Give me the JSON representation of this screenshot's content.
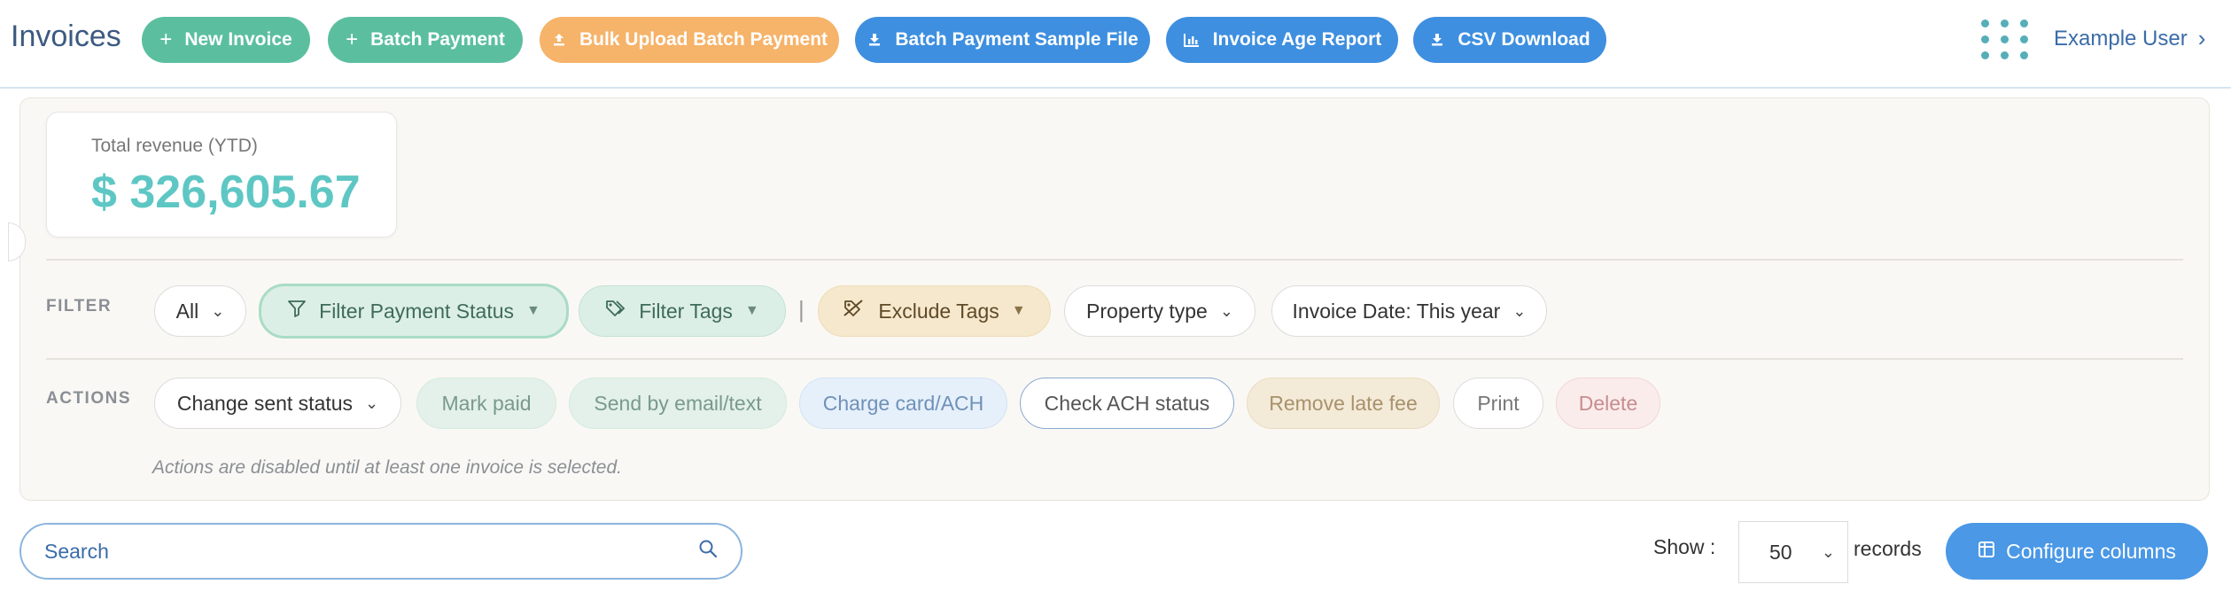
{
  "header": {
    "title": "Invoices",
    "buttons": {
      "new_invoice": "New Invoice",
      "batch_payment": "Batch Payment",
      "bulk_upload": "Bulk Upload Batch Payment",
      "sample_file": "Batch Payment Sample File",
      "age_report": "Invoice Age Report",
      "csv_download": "CSV Download"
    },
    "user_name": "Example User"
  },
  "revenue": {
    "label": "Total revenue (YTD)",
    "value": "$ 326,605.67"
  },
  "filter": {
    "label": "FILTER",
    "all": "All",
    "payment_status": "Filter Payment Status",
    "tags": "Filter Tags",
    "separator": "|",
    "exclude_tags": "Exclude Tags",
    "property_type": "Property type",
    "invoice_date": "Invoice Date: This year"
  },
  "actions": {
    "label": "ACTIONS",
    "change_sent_status": "Change sent status",
    "mark_paid": "Mark paid",
    "send_email": "Send by email/text",
    "charge_card": "Charge card/ACH",
    "check_ach": "Check ACH status",
    "remove_late_fee": "Remove late fee",
    "print": "Print",
    "delete": "Delete",
    "note": "Actions are disabled until at least one invoice is selected."
  },
  "list_controls": {
    "search_placeholder": "Search",
    "show_label": "Show :",
    "show_value": "50",
    "records_label": "records",
    "configure_columns": "Configure columns"
  },
  "colors": {
    "green": "#5bbf9f",
    "orange": "#f6b36a",
    "blue": "#3e8fe0",
    "revenue": "#5ec7c4"
  }
}
